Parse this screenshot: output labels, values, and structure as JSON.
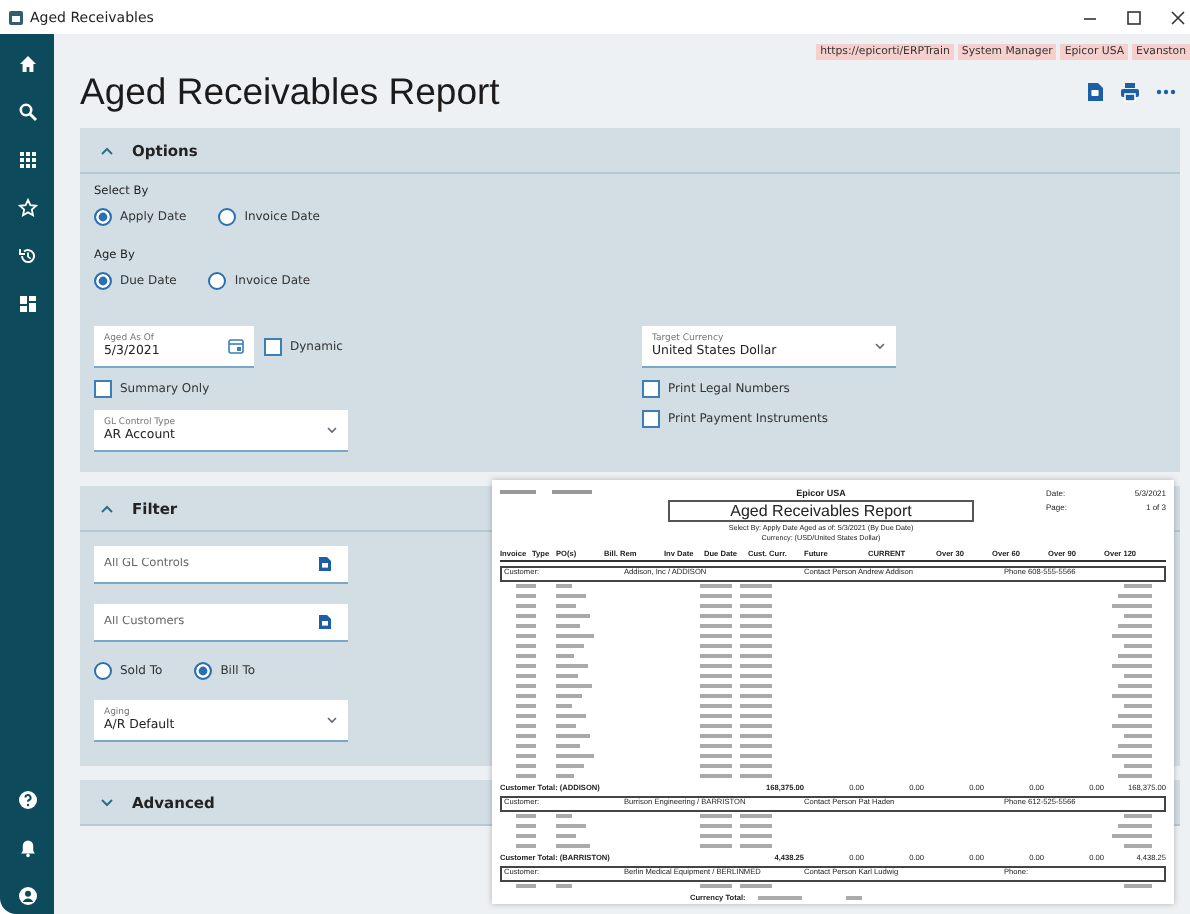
{
  "window": {
    "title": "Aged Receivables"
  },
  "context_tags": [
    "https://epicorti/ERPTrain",
    "System Manager",
    "Epicor USA",
    "Evanston"
  ],
  "page_title": "Aged Receivables Report",
  "options": {
    "title": "Options",
    "expanded": true,
    "select_by": {
      "label": "Select By",
      "choices": [
        {
          "label": "Apply Date",
          "selected": true
        },
        {
          "label": "Invoice Date",
          "selected": false
        }
      ]
    },
    "age_by": {
      "label": "Age By",
      "choices": [
        {
          "label": "Due Date",
          "selected": true
        },
        {
          "label": "Invoice Date",
          "selected": false
        }
      ]
    },
    "aged_as_of": {
      "label": "Aged As Of",
      "value": "5/3/2021"
    },
    "dynamic": {
      "label": "Dynamic",
      "checked": false
    },
    "summary_only": {
      "label": "Summary Only",
      "checked": false
    },
    "gl_control_type": {
      "label": "GL Control Type",
      "value": "AR Account"
    },
    "target_currency": {
      "label": "Target Currency",
      "value": "United States Dollar"
    },
    "print_legal_numbers": {
      "label": "Print Legal Numbers",
      "checked": false
    },
    "print_payment_instruments": {
      "label": "Print Payment Instruments",
      "checked": false
    }
  },
  "filter": {
    "title": "Filter",
    "expanded": true,
    "gl_controls": {
      "placeholder": "All GL Controls"
    },
    "customers": {
      "placeholder": "All Customers"
    },
    "customer_type": [
      {
        "label": "Sold To",
        "selected": false
      },
      {
        "label": "Bill To",
        "selected": true
      }
    ],
    "aging": {
      "label": "Aging",
      "value": "A/R Default"
    }
  },
  "advanced": {
    "title": "Advanced",
    "expanded": false
  },
  "report_preview": {
    "company": "Epicor USA",
    "date_label": "Date:",
    "date": "5/3/2021",
    "page_label": "Page:",
    "page": "1 of 3",
    "title": "Aged Receivables Report",
    "criteria": "Select By: Apply Date     Aged as of: 5/3/2021 (By Due Date)",
    "currency": "Currency: (USD/United States Dollar)",
    "columns": [
      "Invoice",
      "Type",
      "PO(s)",
      "Bill. Rem",
      "Inv Date",
      "Due Date",
      "Cust. Curr.",
      "Future",
      "CURRENT",
      "Over 30",
      "Over 60",
      "Over 90",
      "Over 120"
    ],
    "customers": [
      {
        "label": "Customer:",
        "name": "Addison, Inc / ADDISON",
        "contact": "Contact Person Andrew Addison",
        "phone": "Phone 608-555-5566",
        "total_label": "Customer Total: (ADDISON)",
        "totals": [
          "168,375.00",
          "0.00",
          "0.00",
          "0.00",
          "0.00",
          "0.00",
          "168,375.00"
        ]
      },
      {
        "label": "Customer:",
        "name": "Burrison Engineering / BARRISTON",
        "contact": "Contact Person Pat Haden",
        "phone": "Phone 612-525-5566",
        "total_label": "Customer Total: (BARRISTON)",
        "totals": [
          "4,438.25",
          "0.00",
          "0.00",
          "0.00",
          "0.00",
          "0.00",
          "4,438.25"
        ]
      },
      {
        "label": "Customer:",
        "name": "Berlin Medical Equipment / BERLINMED",
        "contact": "Contact Person Karl Ludwig",
        "phone": "Phone:"
      }
    ],
    "currency_total_label": "Currency Total:"
  }
}
